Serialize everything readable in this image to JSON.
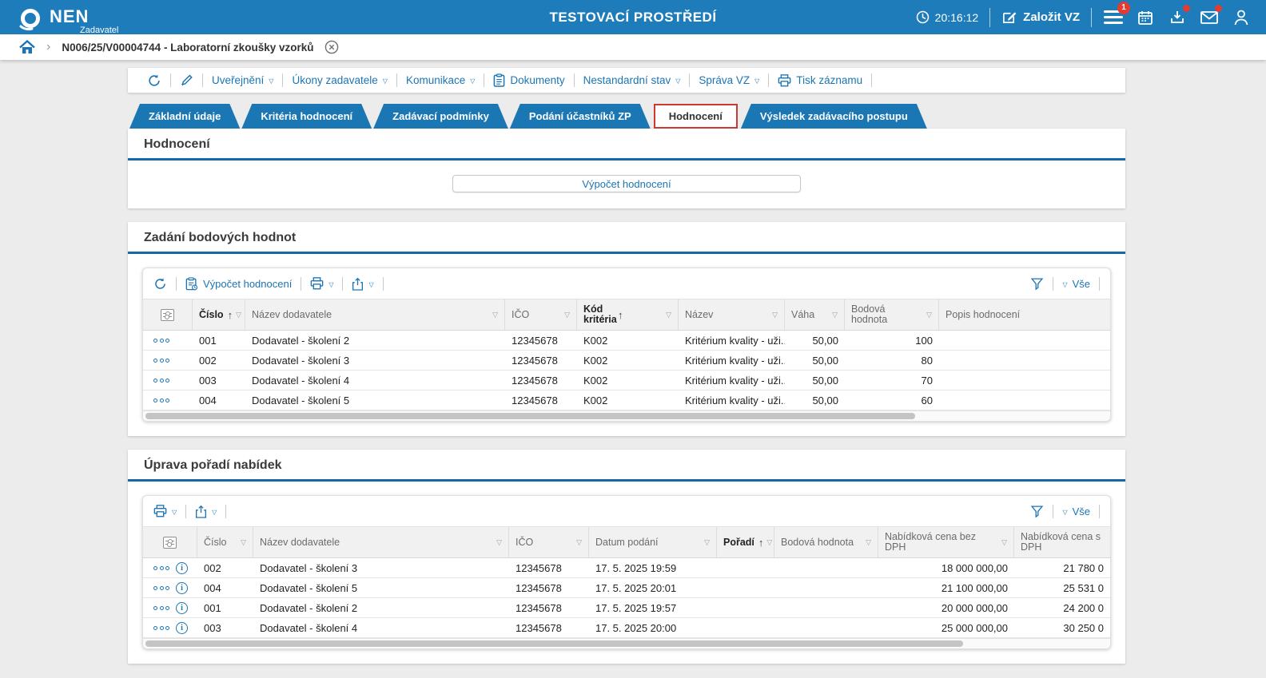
{
  "header": {
    "brand": "NEN",
    "brand_sub": "Zadavatel",
    "env_title": "TESTOVACÍ PROSTŘEDÍ",
    "time": "20:16:12",
    "create_vz": "Založit VZ",
    "menu_badge": "1"
  },
  "breadcrumb": {
    "record_title": "N006/25/V00004744 - Laboratorní zkoušky vzorků"
  },
  "actions_toolbar": {
    "items": [
      "Uveřejnění",
      "Úkony zadavatele",
      "Komunikace",
      "Dokumenty",
      "Nestandardní stav",
      "Správa VZ",
      "Tisk záznamu"
    ]
  },
  "tabs": {
    "items": [
      "Základní údaje",
      "Kritéria hodnocení",
      "Zadávací podmínky",
      "Podání účastníků ZP",
      "Hodnocení",
      "Výsledek zadávacího postupu"
    ],
    "active": "Hodnocení"
  },
  "evaluation_section": {
    "title": "Hodnocení",
    "compute_button": "Výpočet hodnocení"
  },
  "scoring_section": {
    "title": "Zadání bodových hodnot",
    "toolbar": {
      "compute_action": "Výpočet hodnocení",
      "show_all": "Vše"
    },
    "table": {
      "columns": [
        "Číslo",
        "Název dodavatele",
        "IČO",
        "Kód kritéria",
        "Název",
        "Váha",
        "Bodová hodnota",
        "Popis hodnocení"
      ],
      "rows": [
        {
          "cislo": "001",
          "dodavatel": "Dodavatel - školení 2",
          "ico": "12345678",
          "kod": "K002",
          "nazev": "Kritérium kvality - uži...",
          "vaha": "50,00",
          "body": "100",
          "popis": ""
        },
        {
          "cislo": "002",
          "dodavatel": "Dodavatel - školení 3",
          "ico": "12345678",
          "kod": "K002",
          "nazev": "Kritérium kvality - uži...",
          "vaha": "50,00",
          "body": "80",
          "popis": ""
        },
        {
          "cislo": "003",
          "dodavatel": "Dodavatel - školení 4",
          "ico": "12345678",
          "kod": "K002",
          "nazev": "Kritérium kvality - uži...",
          "vaha": "50,00",
          "body": "70",
          "popis": ""
        },
        {
          "cislo": "004",
          "dodavatel": "Dodavatel - školení 5",
          "ico": "12345678",
          "kod": "K002",
          "nazev": "Kritérium kvality - uži...",
          "vaha": "50,00",
          "body": "60",
          "popis": ""
        }
      ]
    }
  },
  "ranking_section": {
    "title": "Úprava pořadí nabídek",
    "toolbar": {
      "show_all": "Vše"
    },
    "table": {
      "columns": [
        "Číslo",
        "Název dodavatele",
        "IČO",
        "Datum podání",
        "Pořadí",
        "Bodová hodnota",
        "Nabídková cena bez DPH",
        "Nabídková cena s DPH"
      ],
      "rows": [
        {
          "cislo": "002",
          "dodavatel": "Dodavatel - školení 3",
          "ico": "12345678",
          "datum": "17. 5. 2025 19:59",
          "poradi": "",
          "body": "",
          "cena_bez": "18 000 000,00",
          "cena_s": "21 780 0"
        },
        {
          "cislo": "004",
          "dodavatel": "Dodavatel - školení 5",
          "ico": "12345678",
          "datum": "17. 5. 2025 20:01",
          "poradi": "",
          "body": "",
          "cena_bez": "21 100 000,00",
          "cena_s": "25 531 0"
        },
        {
          "cislo": "001",
          "dodavatel": "Dodavatel - školení 2",
          "ico": "12345678",
          "datum": "17. 5. 2025 19:57",
          "poradi": "",
          "body": "",
          "cena_bez": "20 000 000,00",
          "cena_s": "24 200 0"
        },
        {
          "cislo": "003",
          "dodavatel": "Dodavatel - školení 4",
          "ico": "12345678",
          "datum": "17. 5. 2025 20:00",
          "poradi": "",
          "body": "",
          "cena_bez": "25 000 000,00",
          "cena_s": "30 250 0"
        }
      ]
    }
  },
  "colors": {
    "header_blue": "#1e7cba",
    "tab_blue": "#1b77b4",
    "link_blue": "#1b75b4",
    "rule_blue": "#1569a8",
    "alert_red": "#e23b32",
    "active_tab_border": "#cb3a32"
  }
}
